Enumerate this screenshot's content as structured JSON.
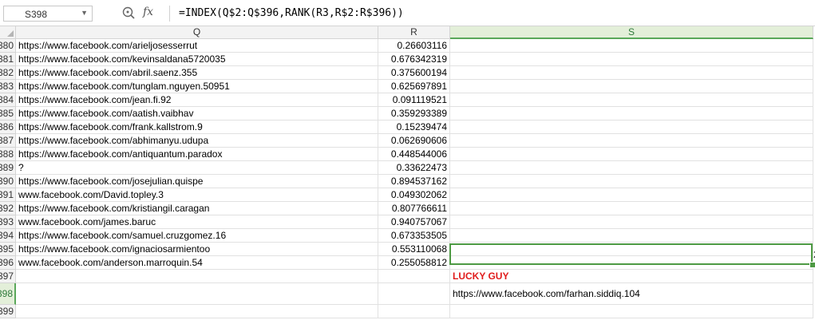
{
  "formula_bar": {
    "name_box": "S398",
    "fx_label": "fx",
    "formula": "=INDEX(Q$2:Q$396,RANK(R3,R$2:R$396))"
  },
  "columns": [
    "Q",
    "R",
    "S"
  ],
  "rows": [
    {
      "num": "380",
      "q": "https://www.facebook.com/arieljosesserrut",
      "r": "0.26603116"
    },
    {
      "num": "381",
      "q": "https://www.facebook.com/kevinsaldana5720035",
      "r": "0.676342319"
    },
    {
      "num": "382",
      "q": "https://www.facebook.com/abril.saenz.355",
      "r": "0.375600194"
    },
    {
      "num": "383",
      "q": "https://www.facebook.com/tunglam.nguyen.50951",
      "r": "0.625697891"
    },
    {
      "num": "384",
      "q": "https://www.facebook.com/jean.fi.92",
      "r": "0.091119521"
    },
    {
      "num": "385",
      "q": "https://www.facebook.com/aatish.vaibhav",
      "r": "0.359293389"
    },
    {
      "num": "386",
      "q": "https://www.facebook.com/frank.kallstrom.9",
      "r": "0.15239474"
    },
    {
      "num": "387",
      "q": "https://www.facebook.com/abhimanyu.udupa",
      "r": "0.062690606"
    },
    {
      "num": "388",
      "q": "https://www.facebook.com/antiquantum.paradox",
      "r": "0.448544006"
    },
    {
      "num": "389",
      "q": "?",
      "r": "0.33622473"
    },
    {
      "num": "390",
      "q": "https://www.facebook.com/josejulian.quispe",
      "r": "0.894537162"
    },
    {
      "num": "391",
      "q": "www.facebook.com/David.topley.3",
      "r": "0.049302062"
    },
    {
      "num": "392",
      "q": "https://www.facebook.com/kristiangil.caragan",
      "r": "0.807766611"
    },
    {
      "num": "393",
      "q": "www.facebook.com/james.baruc",
      "r": "0.940757067"
    },
    {
      "num": "394",
      "q": "https://www.facebook.com/samuel.cruzgomez.16",
      "r": "0.673353505"
    },
    {
      "num": "395",
      "q": "https://www.facebook.com/ignaciosarmientoo",
      "r": "0.553110068"
    },
    {
      "num": "396",
      "q": "www.facebook.com/anderson.marroquin.54",
      "r": "0.255058812"
    }
  ],
  "row397": {
    "num": "397",
    "s": "LUCKY GUY"
  },
  "row398": {
    "num": "398",
    "s": "https://www.facebook.com/farhan.siddiq.104",
    "edge": "2"
  },
  "row399": {
    "num": "399"
  },
  "colors": {
    "accent": "#4e9a44",
    "lucky": "#e01b1b"
  }
}
